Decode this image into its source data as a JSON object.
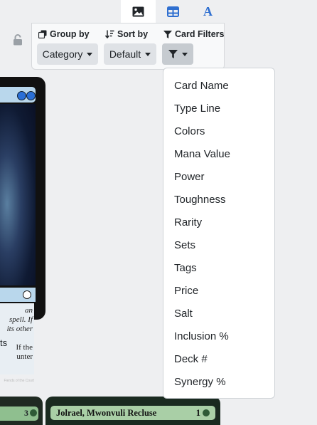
{
  "view_tabs": [
    {
      "icon": "image-icon",
      "active": true
    },
    {
      "icon": "table-icon",
      "active": false
    },
    {
      "icon": "text-icon",
      "glyph": "A",
      "active": false
    }
  ],
  "colors": {
    "accent_blue": "#2f6fd0",
    "panel_bg": "#f8f9fa",
    "button_bg": "#dfe2e6",
    "page_bg": "#eeeff1"
  },
  "toolbar": {
    "group_by": {
      "label": "Group by",
      "value": "Category"
    },
    "sort_by": {
      "label": "Sort by",
      "value": "Default"
    },
    "card_filters": {
      "label": "Card Filters"
    }
  },
  "filter_menu": {
    "items": [
      "Card Name",
      "Type Line",
      "Colors",
      "Mana Value",
      "Power",
      "Toughness",
      "Rarity",
      "Sets",
      "Tags",
      "Price",
      "Salt",
      "Inclusion %",
      "Deck #",
      "Synergy %"
    ]
  },
  "left_card": {
    "text_lines": [
      "an",
      "spell. If",
      "its other",
      "",
      "If the",
      "unter"
    ],
    "footer": "Fiends of the Court"
  },
  "stray_text": "ts",
  "bottom_cards": [
    {
      "name": "",
      "cost": "3"
    },
    {
      "name": "Jolrael, Mwonvuli Recluse",
      "cost": "1"
    }
  ]
}
